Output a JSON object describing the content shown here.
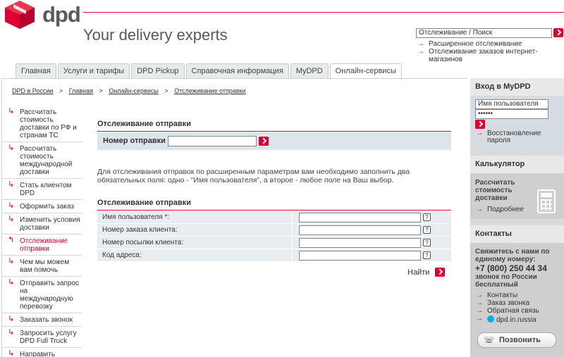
{
  "header": {
    "logo_text": "dpd",
    "tagline": "Your delivery experts",
    "search": {
      "value": "Отслеживание / Поиск",
      "links": [
        "Расширенное отслеживание",
        "Отслеживание заказов интернет-магазинов"
      ]
    }
  },
  "tabs": [
    {
      "label": "Главная"
    },
    {
      "label": "Услуги и тарифы"
    },
    {
      "label": "DPD Pickup"
    },
    {
      "label": "Справочная информация"
    },
    {
      "label": "MyDPD"
    },
    {
      "label": "Онлайн-сервисы",
      "active": true
    }
  ],
  "breadcrumb": {
    "items": [
      "DPD в России",
      "Главная",
      "Онлайн-сервисы",
      "Отслеживание отправки"
    ],
    "separator": ">"
  },
  "leftmenu": {
    "items": [
      {
        "label": "Рассчитать стоимость доставки по РФ и странам ТС"
      },
      {
        "label": "Рассчитать стоимость международной доставки"
      },
      {
        "label": "Стать клиентом DPD"
      },
      {
        "label": "Оформить заказ"
      },
      {
        "label": "Изменить условия доставки"
      },
      {
        "label": "Отслеживание отправки",
        "active": true
      },
      {
        "label": "Чем мы можем вам помочь"
      },
      {
        "label": "Отправить запрос на международную перевозку"
      },
      {
        "label": "Заказать звонок"
      },
      {
        "label": "Запросить услугу DPD Full Truck"
      },
      {
        "label": "Направить претензию"
      }
    ]
  },
  "main": {
    "section1_title": "Отслеживание отправки",
    "tracking_label": "Номер отправки",
    "tracking_value": "",
    "info_text": "Для отслеживания отправок по расширенным параметрам вам необходимо заполнить два обязательных поля: одно - \"Имя пользователя\", а второе - любое поле на Ваш выбор.",
    "section2_title": "Отслеживание отправки",
    "form_rows": [
      {
        "label": "Имя пользователя",
        "required_mark": "*:",
        "value": ""
      },
      {
        "label": "Номер заказа клиента:",
        "required_mark": "",
        "value": ""
      },
      {
        "label": "Номер посылки клиента:",
        "required_mark": "",
        "value": ""
      },
      {
        "label": "Код адреса:",
        "required_mark": "",
        "value": ""
      }
    ],
    "help_glyph": "?",
    "find_label": "Найти"
  },
  "sidebar": {
    "login": {
      "title": "Вход в MyDPD",
      "username_placeholder": "Имя пользователя",
      "password_value": "••••••",
      "restore_link": "Восстановление пароля"
    },
    "calculator": {
      "title": "Калькулятор",
      "text": "Рассчитать стоимость доставки",
      "link": "Подробнее"
    },
    "contacts": {
      "title": "Контакты",
      "lead": "Свяжитесь с нами по единому номеру:",
      "phone": "+7 (800) 250 44 34",
      "note": "звонок по России бесплатный",
      "links": [
        "Контакты",
        "Заказ звонка",
        "Обратная связь",
        "dpd.in.russia"
      ],
      "call_button": "Позвонить"
    }
  },
  "colors": {
    "brand_red": "#dc0032",
    "tab_bg": "#e6ecec",
    "row_bg": "#dde4ea",
    "sidebar_bg": "#dadada"
  }
}
